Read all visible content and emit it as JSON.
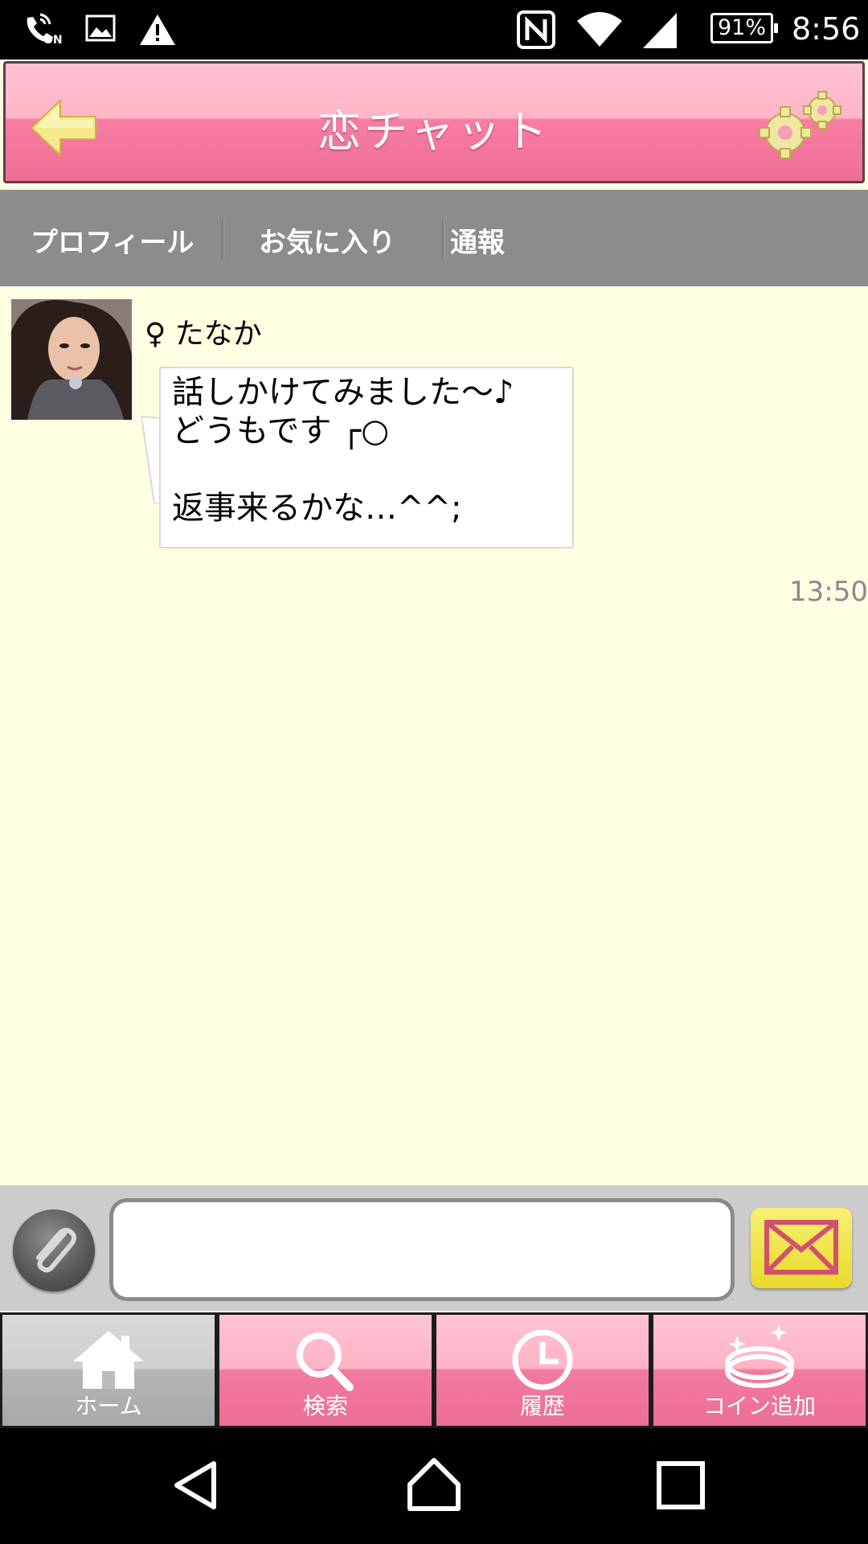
{
  "status_bar": {
    "icons": [
      "nfc-call-icon",
      "image-icon",
      "warning-icon",
      "nfc-icon",
      "wifi-icon",
      "signal-icon"
    ],
    "nfc_on_label": "ON",
    "battery": "91%",
    "time": "8:56"
  },
  "header": {
    "title": "恋チャット",
    "back_icon": "arrow-left-icon",
    "settings_icon": "gears-icon"
  },
  "subnav": {
    "items": [
      {
        "label": "プロフィール"
      },
      {
        "label": "お気に入り"
      },
      {
        "label": "通報"
      }
    ]
  },
  "chat": {
    "messages": [
      {
        "sender": "♀ たなか",
        "lines": [
          "話しかけてみました〜♪",
          "どうもです ┌○",
          "",
          "返事来るかな…^^;"
        ],
        "time": "13:50"
      }
    ]
  },
  "composer": {
    "input_value": "",
    "input_placeholder": "",
    "attach_icon": "paperclip-icon",
    "send_icon": "envelope-icon"
  },
  "tabs": [
    {
      "label": "ホーム",
      "icon": "home-icon",
      "active": true
    },
    {
      "label": "検索",
      "icon": "search-icon",
      "active": false
    },
    {
      "label": "履歴",
      "icon": "clock-icon",
      "active": false
    },
    {
      "label": "コイン追加",
      "icon": "coin-icon",
      "active": false
    }
  ],
  "nav_bar": {
    "buttons": [
      "back-icon",
      "home-icon",
      "recents-icon"
    ]
  },
  "colors": {
    "header_pink": "#ee6e95",
    "chat_background": "#fffee3",
    "subnav_gray": "#8c8c8c",
    "send_yellow": "#e8d92a"
  }
}
